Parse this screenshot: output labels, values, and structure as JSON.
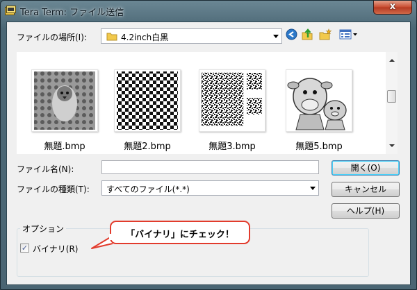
{
  "window": {
    "title": "Tera Term: ファイル送信",
    "close_glyph": "x"
  },
  "location": {
    "label": "ファイルの場所(I):",
    "value": "4.2inch白黒"
  },
  "toolbar_icons": [
    "back-icon",
    "up-folder-icon",
    "new-folder-icon",
    "view-menu-icon"
  ],
  "files": [
    {
      "name": "無題.bmp",
      "preview": "bird-pattern"
    },
    {
      "name": "無題2.bmp",
      "preview": "checkerboard"
    },
    {
      "name": "無題3.bmp",
      "preview": "qr-noise"
    },
    {
      "name": "無題5.bmp",
      "preview": "cow-illustration"
    }
  ],
  "filename": {
    "label": "ファイル名(N):",
    "value": ""
  },
  "filetype": {
    "label": "ファイルの種類(T):",
    "value": "すべてのファイル(*.*)"
  },
  "buttons": {
    "open": "開く(O)",
    "cancel": "キャンセル",
    "help": "ヘルプ(H)"
  },
  "options": {
    "group_title": "オプション",
    "binary_label": "バイナリ(R)",
    "binary_checked": true,
    "check_glyph": "✓"
  },
  "annotation": {
    "text": "「バイナリ」にチェック！",
    "border_color": "#e23b2c"
  },
  "colors": {
    "frame": "#4b6775",
    "close_button": "#c84a2f",
    "dialog_bg": "#f0f0f0"
  }
}
